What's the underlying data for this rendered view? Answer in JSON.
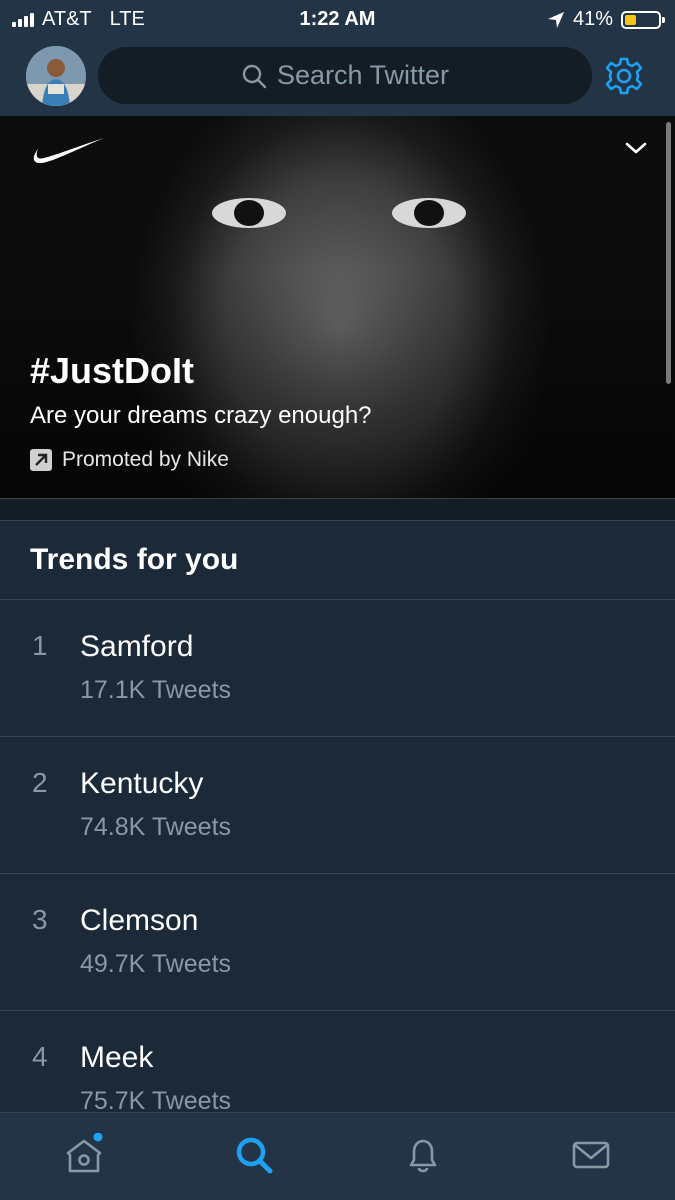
{
  "status_bar": {
    "carrier": "AT&T",
    "network": "LTE",
    "time": "1:22 AM",
    "battery": "41%",
    "battery_level": 0.41
  },
  "header": {
    "search_placeholder": "Search Twitter"
  },
  "promo": {
    "hashtag": "#JustDoIt",
    "tagline": "Are your dreams crazy enough?",
    "promoted_by": "Promoted by Nike"
  },
  "trends": {
    "title": "Trends for you",
    "items": [
      {
        "rank": "1",
        "name": "Samford",
        "count": "17.1K Tweets"
      },
      {
        "rank": "2",
        "name": "Kentucky",
        "count": "74.8K Tweets"
      },
      {
        "rank": "3",
        "name": "Clemson",
        "count": "49.7K Tweets"
      },
      {
        "rank": "4",
        "name": "Meek",
        "count": "75.7K Tweets"
      }
    ]
  },
  "tabbar": {
    "tabs": [
      "home-icon",
      "search-icon",
      "bell-icon",
      "mail-icon"
    ],
    "active": "search-icon"
  },
  "colors": {
    "accent": "#1da1f2",
    "background": "#141d26",
    "panel": "#1c2938",
    "bar": "#243447",
    "muted": "#8899a6",
    "battery": "#f5c518"
  }
}
